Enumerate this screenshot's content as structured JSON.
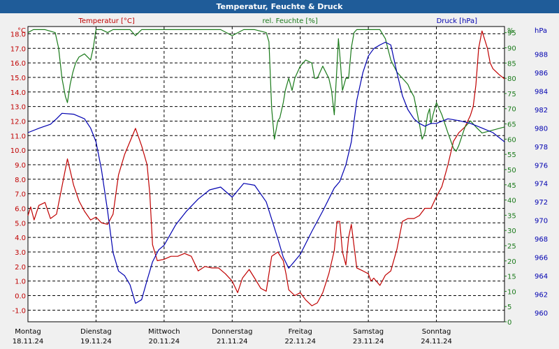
{
  "window": {
    "title": "Temperatur, Feuchte & Druck"
  },
  "chart_data": {
    "type": "line",
    "title": "Temperatur, Feuchte & Druck",
    "x_labels": [
      {
        "day": "Montag",
        "date": "18.11.24"
      },
      {
        "day": "Dienstag",
        "date": "19.11.24"
      },
      {
        "day": "Mittwoch",
        "date": "20.11.24"
      },
      {
        "day": "Donnerstag",
        "date": "21.11.24"
      },
      {
        "day": "Freitag",
        "date": "22.11.24"
      },
      {
        "day": "Samstag",
        "date": "23.11.24"
      },
      {
        "day": "Sonntag",
        "date": "24.11.24"
      }
    ],
    "x_range": [
      "18.11.24",
      "24.11.24 24:00"
    ],
    "axes": {
      "temperature": {
        "label": "Temperatur [°C]",
        "unit": "°C",
        "side": "left",
        "range": [
          -1.8,
          18.5
        ],
        "ticks": [
          -1.0,
          0.0,
          1.0,
          2.0,
          3.0,
          4.0,
          5.0,
          6.0,
          7.0,
          8.0,
          9.0,
          10.0,
          11.0,
          12.0,
          13.0,
          14.0,
          15.0,
          16.0,
          17.0,
          18.0
        ],
        "tick_decimals": 1
      },
      "humidity": {
        "label": "rel. Feuchte [%]",
        "unit": "%",
        "side": "right",
        "range": [
          0,
          97
        ],
        "ticks": [
          0,
          5,
          10,
          15,
          20,
          25,
          30,
          35,
          40,
          45,
          50,
          55,
          60,
          65,
          70,
          75,
          80,
          85,
          90,
          95
        ],
        "tick_decimals": 0
      },
      "pressure": {
        "label": "Druck [hPa]",
        "unit": "hPa",
        "side": "right",
        "range": [
          959,
          991
        ],
        "ticks": [
          960,
          962,
          964,
          966,
          968,
          970,
          972,
          974,
          976,
          978,
          980,
          982,
          984,
          986,
          988
        ],
        "tick_decimals": 0
      }
    },
    "grid": true,
    "series": [
      {
        "name": "Temperatur [°C]",
        "axis": "temperature",
        "color": "#c00000",
        "points": [
          [
            0,
            5.5
          ],
          [
            0.04,
            6.1
          ],
          [
            0.09,
            5.2
          ],
          [
            0.16,
            6.2
          ],
          [
            0.25,
            6.4
          ],
          [
            0.33,
            5.3
          ],
          [
            0.42,
            5.6
          ],
          [
            0.5,
            7.5
          ],
          [
            0.58,
            9.4
          ],
          [
            0.67,
            7.6
          ],
          [
            0.75,
            6.5
          ],
          [
            0.83,
            5.8
          ],
          [
            0.92,
            5.2
          ],
          [
            1.0,
            5.4
          ],
          [
            1.08,
            5.0
          ],
          [
            1.17,
            4.9
          ],
          [
            1.25,
            5.6
          ],
          [
            1.33,
            8.3
          ],
          [
            1.42,
            9.7
          ],
          [
            1.5,
            10.6
          ],
          [
            1.58,
            11.5
          ],
          [
            1.67,
            10.3
          ],
          [
            1.75,
            9.0
          ],
          [
            1.79,
            7.0
          ],
          [
            1.83,
            3.5
          ],
          [
            1.9,
            2.4
          ],
          [
            2.0,
            2.5
          ],
          [
            2.1,
            2.7
          ],
          [
            2.2,
            2.7
          ],
          [
            2.3,
            2.9
          ],
          [
            2.4,
            2.7
          ],
          [
            2.5,
            1.7
          ],
          [
            2.6,
            2.0
          ],
          [
            2.7,
            1.9
          ],
          [
            2.8,
            1.9
          ],
          [
            2.9,
            1.5
          ],
          [
            3.0,
            1.0
          ],
          [
            3.08,
            0.2
          ],
          [
            3.15,
            1.2
          ],
          [
            3.25,
            1.8
          ],
          [
            3.33,
            1.2
          ],
          [
            3.42,
            0.5
          ],
          [
            3.5,
            0.3
          ],
          [
            3.58,
            2.7
          ],
          [
            3.67,
            3.0
          ],
          [
            3.75,
            2.4
          ],
          [
            3.79,
            1.5
          ],
          [
            3.83,
            0.4
          ],
          [
            3.92,
            0.0
          ],
          [
            4.0,
            0.2
          ],
          [
            4.08,
            -0.3
          ],
          [
            4.17,
            -0.7
          ],
          [
            4.25,
            -0.5
          ],
          [
            4.33,
            0.2
          ],
          [
            4.42,
            1.5
          ],
          [
            4.5,
            3.1
          ],
          [
            4.54,
            5.1
          ],
          [
            4.58,
            5.1
          ],
          [
            4.62,
            3.0
          ],
          [
            4.67,
            2.1
          ],
          [
            4.71,
            4.0
          ],
          [
            4.75,
            4.9
          ],
          [
            4.79,
            3.4
          ],
          [
            4.83,
            1.9
          ],
          [
            4.92,
            1.7
          ],
          [
            5.0,
            1.5
          ],
          [
            5.04,
            1.0
          ],
          [
            5.08,
            1.2
          ],
          [
            5.17,
            0.7
          ],
          [
            5.25,
            1.4
          ],
          [
            5.33,
            1.7
          ],
          [
            5.42,
            3.2
          ],
          [
            5.5,
            5.1
          ],
          [
            5.58,
            5.3
          ],
          [
            5.67,
            5.3
          ],
          [
            5.75,
            5.5
          ],
          [
            5.83,
            6.0
          ],
          [
            5.92,
            6.0
          ],
          [
            6.0,
            6.8
          ],
          [
            6.08,
            7.5
          ],
          [
            6.17,
            9.0
          ],
          [
            6.25,
            10.6
          ],
          [
            6.33,
            11.2
          ],
          [
            6.42,
            11.6
          ],
          [
            6.5,
            12.4
          ],
          [
            6.54,
            13.0
          ],
          [
            6.58,
            14.5
          ],
          [
            6.62,
            17.0
          ],
          [
            6.67,
            18.2
          ],
          [
            6.71,
            17.6
          ],
          [
            6.75,
            17.0
          ],
          [
            6.79,
            16.0
          ],
          [
            6.83,
            15.6
          ],
          [
            6.92,
            15.2
          ],
          [
            7.0,
            14.9
          ]
        ]
      },
      {
        "name": "rel. Feuchte [%]",
        "axis": "humidity",
        "color": "#1a7a1a",
        "points": [
          [
            0,
            95
          ],
          [
            0.08,
            96
          ],
          [
            0.25,
            96
          ],
          [
            0.4,
            95
          ],
          [
            0.45,
            90
          ],
          [
            0.5,
            80
          ],
          [
            0.55,
            74
          ],
          [
            0.58,
            72
          ],
          [
            0.62,
            78
          ],
          [
            0.66,
            82
          ],
          [
            0.7,
            85
          ],
          [
            0.75,
            87
          ],
          [
            0.83,
            88
          ],
          [
            0.92,
            86
          ],
          [
            0.96,
            90
          ],
          [
            1.0,
            96
          ],
          [
            1.08,
            96
          ],
          [
            1.17,
            95
          ],
          [
            1.25,
            96
          ],
          [
            1.33,
            96
          ],
          [
            1.5,
            96
          ],
          [
            1.58,
            94
          ],
          [
            1.67,
            96
          ],
          [
            1.75,
            96
          ],
          [
            2.0,
            96
          ],
          [
            2.5,
            96
          ],
          [
            2.83,
            96
          ],
          [
            3.0,
            94
          ],
          [
            3.17,
            96
          ],
          [
            3.33,
            96
          ],
          [
            3.5,
            95
          ],
          [
            3.54,
            92
          ],
          [
            3.58,
            70
          ],
          [
            3.62,
            60
          ],
          [
            3.67,
            66
          ],
          [
            3.7,
            67
          ],
          [
            3.75,
            72
          ],
          [
            3.78,
            76
          ],
          [
            3.83,
            80
          ],
          [
            3.88,
            76
          ],
          [
            3.92,
            80
          ],
          [
            3.96,
            82
          ],
          [
            4.0,
            84
          ],
          [
            4.08,
            86
          ],
          [
            4.17,
            85
          ],
          [
            4.21,
            80
          ],
          [
            4.25,
            80
          ],
          [
            4.33,
            84
          ],
          [
            4.42,
            80
          ],
          [
            4.46,
            76
          ],
          [
            4.5,
            68
          ],
          [
            4.54,
            84
          ],
          [
            4.56,
            93
          ],
          [
            4.58,
            88
          ],
          [
            4.62,
            76
          ],
          [
            4.67,
            80
          ],
          [
            4.71,
            80
          ],
          [
            4.75,
            90
          ],
          [
            4.79,
            95
          ],
          [
            4.83,
            96
          ],
          [
            5.0,
            96
          ],
          [
            5.17,
            96
          ],
          [
            5.25,
            93
          ],
          [
            5.33,
            86
          ],
          [
            5.42,
            82
          ],
          [
            5.5,
            80
          ],
          [
            5.58,
            78
          ],
          [
            5.62,
            76
          ],
          [
            5.67,
            74
          ],
          [
            5.75,
            65
          ],
          [
            5.79,
            60
          ],
          [
            5.83,
            62
          ],
          [
            5.87,
            68
          ],
          [
            5.9,
            70
          ],
          [
            5.92,
            65
          ],
          [
            5.95,
            68
          ],
          [
            6.0,
            72
          ],
          [
            6.08,
            68
          ],
          [
            6.17,
            62
          ],
          [
            6.25,
            57
          ],
          [
            6.29,
            56
          ],
          [
            6.33,
            58
          ],
          [
            6.42,
            64
          ],
          [
            6.5,
            66
          ],
          [
            6.58,
            64
          ],
          [
            6.67,
            62
          ],
          [
            7.0,
            64
          ]
        ]
      },
      {
        "name": "Druck [hPa]",
        "axis": "pressure",
        "color": "#0000b0",
        "points": [
          [
            0,
            979.5
          ],
          [
            0.17,
            980.0
          ],
          [
            0.33,
            980.4
          ],
          [
            0.42,
            981.0
          ],
          [
            0.5,
            981.6
          ],
          [
            0.67,
            981.5
          ],
          [
            0.83,
            981.0
          ],
          [
            0.92,
            980.0
          ],
          [
            1.0,
            978.5
          ],
          [
            1.08,
            975.5
          ],
          [
            1.17,
            971.0
          ],
          [
            1.25,
            966.5
          ],
          [
            1.33,
            964.5
          ],
          [
            1.42,
            964.0
          ],
          [
            1.5,
            963.0
          ],
          [
            1.58,
            961.0
          ],
          [
            1.67,
            961.4
          ],
          [
            1.75,
            963.5
          ],
          [
            1.83,
            965.5
          ],
          [
            1.92,
            966.8
          ],
          [
            2.0,
            967.3
          ],
          [
            2.17,
            969.5
          ],
          [
            2.33,
            971.0
          ],
          [
            2.5,
            972.3
          ],
          [
            2.67,
            973.3
          ],
          [
            2.83,
            973.6
          ],
          [
            3.0,
            972.5
          ],
          [
            3.17,
            974.0
          ],
          [
            3.33,
            973.8
          ],
          [
            3.5,
            972.0
          ],
          [
            3.67,
            968.0
          ],
          [
            3.75,
            966.0
          ],
          [
            3.83,
            964.8
          ],
          [
            4.0,
            966.3
          ],
          [
            4.17,
            968.8
          ],
          [
            4.33,
            971.0
          ],
          [
            4.5,
            973.5
          ],
          [
            4.58,
            974.2
          ],
          [
            4.67,
            976.0
          ],
          [
            4.75,
            978.5
          ],
          [
            4.83,
            983.0
          ],
          [
            4.92,
            986.0
          ],
          [
            5.0,
            987.8
          ],
          [
            5.08,
            988.6
          ],
          [
            5.17,
            989.0
          ],
          [
            5.25,
            989.3
          ],
          [
            5.33,
            989.0
          ],
          [
            5.42,
            986.0
          ],
          [
            5.5,
            983.5
          ],
          [
            5.58,
            982.0
          ],
          [
            5.67,
            981.0
          ],
          [
            5.75,
            980.5
          ],
          [
            5.83,
            980.2
          ],
          [
            5.92,
            980.5
          ],
          [
            6.0,
            980.5
          ],
          [
            6.17,
            981.0
          ],
          [
            6.33,
            980.8
          ],
          [
            6.5,
            980.5
          ],
          [
            6.67,
            980.0
          ],
          [
            6.83,
            979.5
          ],
          [
            7.0,
            978.5
          ]
        ]
      }
    ]
  }
}
